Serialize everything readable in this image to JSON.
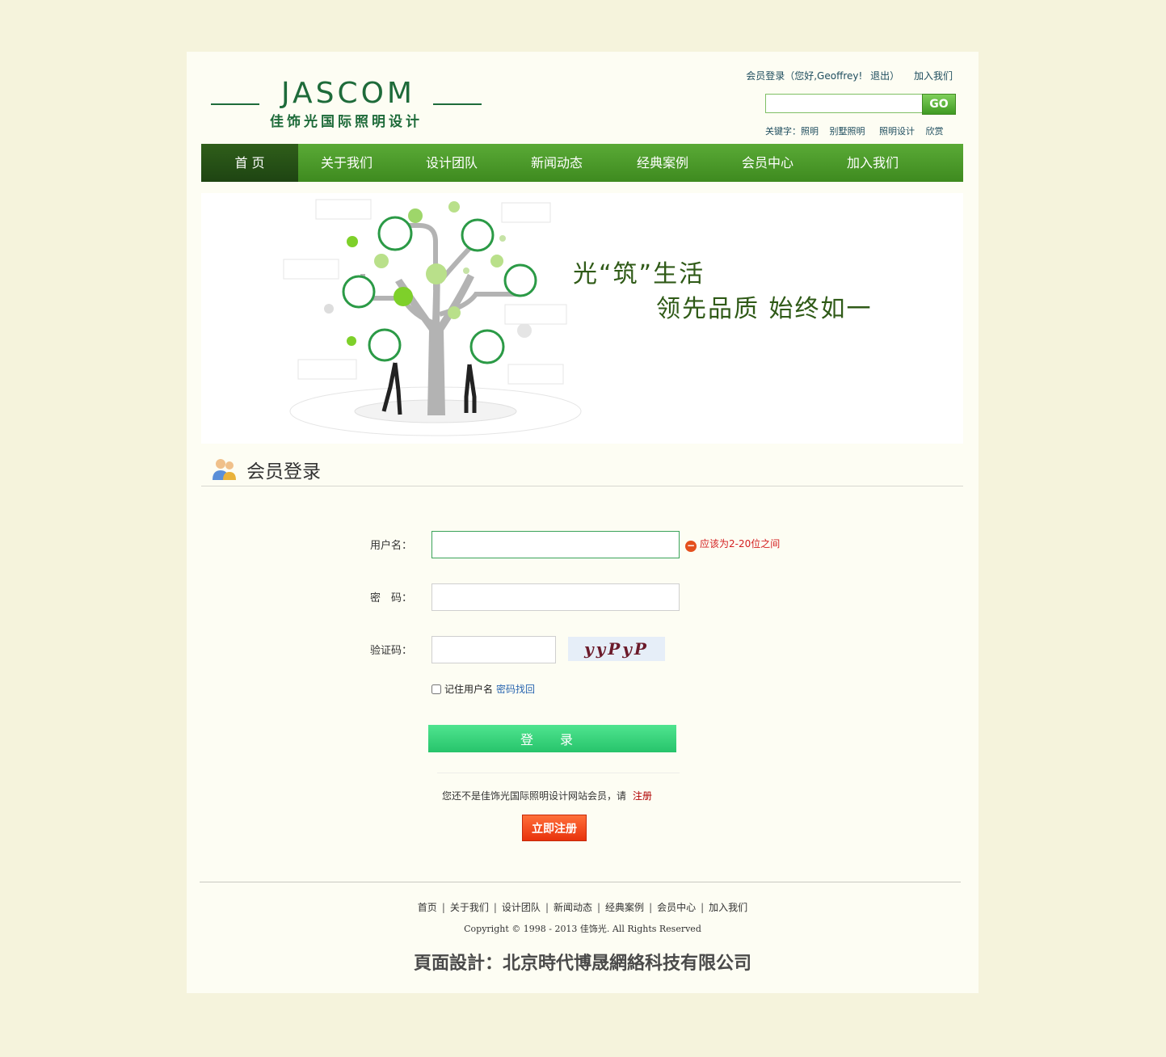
{
  "header": {
    "logo_text": "JASCOM",
    "logo_sub": "佳饰光国际照明设计",
    "member_login": "会员登录（",
    "greeting": "您好,Geoffrey!",
    "logout": "退出）",
    "join_us": "加入我们",
    "search_placeholder": "",
    "search_button": "GO",
    "keywords_label": "关键字：",
    "keywords": [
      "照明",
      "别墅照明",
      "照明设计",
      "欣赏"
    ]
  },
  "nav": {
    "items": [
      "首 页",
      "关于我们",
      "设计团队",
      "新闻动态",
      "经典案例",
      "会员中心",
      "加入我们"
    ],
    "active_index": 0
  },
  "banner": {
    "slogan_line1": "光“筑”生活",
    "slogan_line2": "领先品质 始终如一"
  },
  "section": {
    "title": "会员登录"
  },
  "form": {
    "username_label": "用户名：",
    "username_value": "",
    "username_error": "应该为2-20位之间",
    "password_label": "密　码：",
    "password_value": "",
    "captcha_label": "验证码：",
    "captcha_value": "",
    "captcha_text": "yyPyP",
    "remember_label": "记住用户名",
    "forgot_link": "密码找回",
    "login_button": "登 录",
    "not_member_text": "您还不是佳饰光国际照明设计网站会员，请",
    "register_link": "注册",
    "register_button": "立即注册"
  },
  "footer": {
    "links": [
      "首页",
      "关于我们",
      "设计团队",
      "新闻动态",
      "经典案例",
      "会员中心",
      "加入我们"
    ],
    "copyright": "Copyright © 1998 - 2013 佳饰光. All Rights Reserved",
    "designer": "頁面設計：北京時代博晟網絡科技有限公司"
  },
  "colors": {
    "page_bg": "#f5f3dc",
    "nav_green": "#4a9a2a",
    "brand_green": "#1e6b3a",
    "error_red": "#d42020",
    "login_green": "#2fd072",
    "register_orange": "#f04a1a"
  }
}
